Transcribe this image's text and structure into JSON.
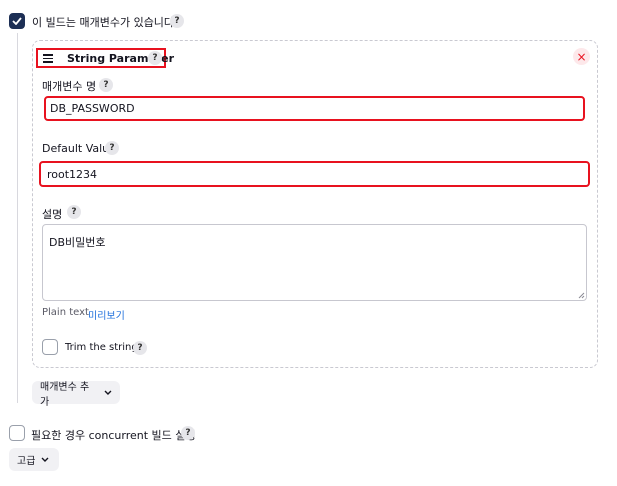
{
  "parameterized": {
    "label": "이 빌드는 매개변수가 있습니다",
    "help": "?",
    "checked": true
  },
  "param": {
    "type_label": "String Parameter",
    "help": "?",
    "close_glyph": "×",
    "name_label": "매개변수 명",
    "name_value": "DB_PASSWORD",
    "default_label": "Default Value",
    "default_value": "root1234",
    "desc_label": "설명",
    "desc_value": "DB비밀번호",
    "plain_text": "Plain text",
    "preview": "미리보기",
    "trim_label": "Trim the string",
    "trim_checked": false
  },
  "add_param": {
    "label": "매개변수 추가"
  },
  "concurrent": {
    "label": "필요한 경우 concurrent 빌드 실행",
    "help": "?",
    "checked": false
  },
  "advanced": {
    "label": "고급"
  },
  "colors": {
    "accent": "#1d2f55",
    "highlight": "#e8121f",
    "link": "#1e6fdc"
  }
}
